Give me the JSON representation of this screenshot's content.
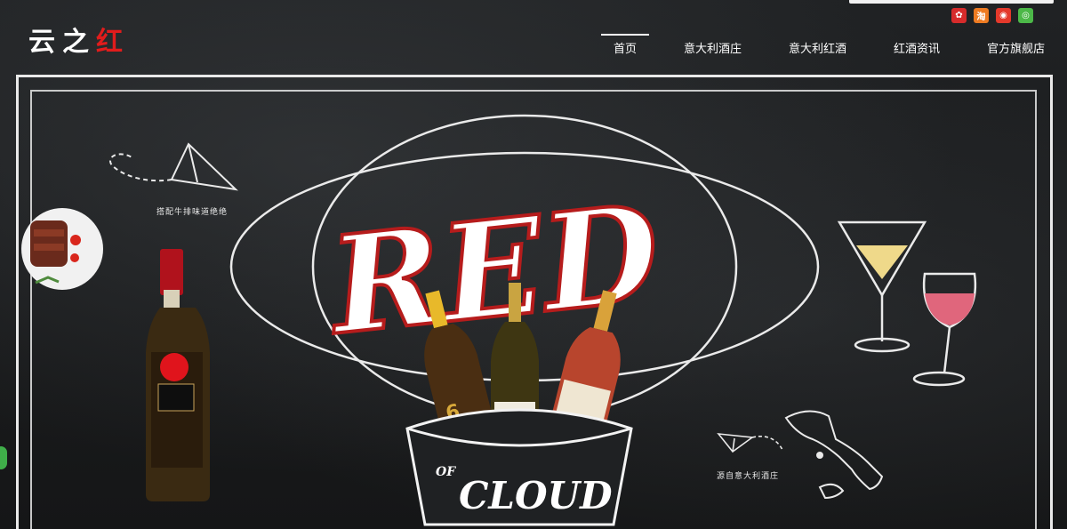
{
  "brand": {
    "logo_main": "云之",
    "logo_red": "红"
  },
  "nav": {
    "items": [
      {
        "label": "首页",
        "active": true
      },
      {
        "label": "意大利酒庄",
        "active": false
      },
      {
        "label": "意大利红酒",
        "active": false
      },
      {
        "label": "红酒资讯",
        "active": false
      },
      {
        "label": "官方旗舰店",
        "active": false
      }
    ]
  },
  "socials": [
    {
      "name": "weibo-red-icon",
      "color": "#d62b2b"
    },
    {
      "name": "taobao-icon",
      "color": "#ee7b22"
    },
    {
      "name": "weibo-icon",
      "color": "#e4392b"
    },
    {
      "name": "wechat-icon",
      "color": "#4cb848"
    }
  ],
  "banner": {
    "headline": "RED",
    "sub_of": "OF",
    "sub_cloud": "CLOUD",
    "chalk_left": "搭配牛排味道绝绝",
    "chalk_right": "源自意大利酒庄",
    "bottle_label_6": "6"
  },
  "colors": {
    "accent_red": "#e11c1c",
    "chalk": "#e8e8e8",
    "background": "#1d1f21"
  }
}
